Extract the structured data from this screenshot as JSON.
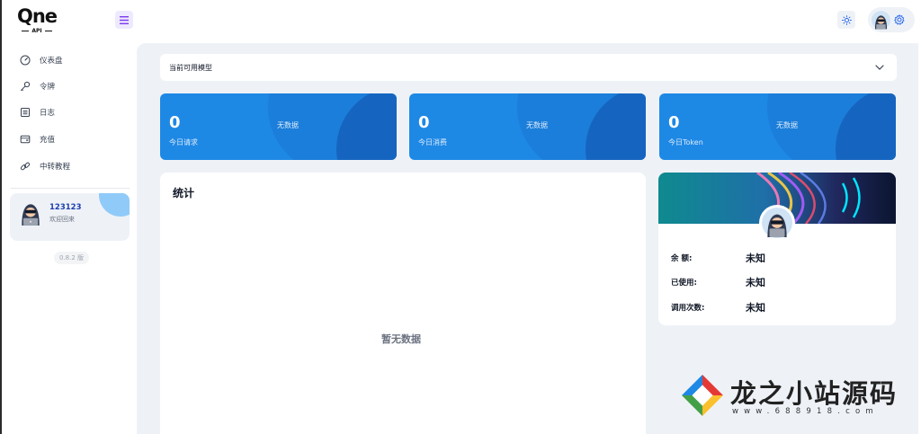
{
  "app": {
    "logo_text": "Qne",
    "logo_sub": "API"
  },
  "sidebar": {
    "items": [
      {
        "label": "仪表盘",
        "icon": "gauge-icon"
      },
      {
        "label": "令牌",
        "icon": "key-icon"
      },
      {
        "label": "日志",
        "icon": "log-icon"
      },
      {
        "label": "充值",
        "icon": "wallet-icon"
      },
      {
        "label": "中转教程",
        "icon": "link-icon"
      }
    ],
    "user": {
      "name": "123123",
      "greeting": "欢迎回来"
    },
    "version": "0.8.2 版"
  },
  "main": {
    "model_select": {
      "label": "当前可用模型"
    },
    "stats": [
      {
        "value": "0",
        "label": "今日请求",
        "nodata": "无数据"
      },
      {
        "value": "0",
        "label": "今日消费",
        "nodata": "无数据"
      },
      {
        "value": "0",
        "label": "今日Token",
        "nodata": "无数据"
      }
    ],
    "chart": {
      "title": "统计",
      "empty_text": "暂无数据"
    },
    "balance": {
      "rows": [
        {
          "key": "余 额:",
          "value": "未知"
        },
        {
          "key": "已使用:",
          "value": "未知"
        },
        {
          "key": "调用次数:",
          "value": "未知"
        }
      ]
    }
  },
  "watermark": {
    "title": "龙之小站源码",
    "url": "www.688918.com"
  },
  "colors": {
    "accent": "#1e88e5",
    "main_bg": "#eef2f7",
    "menu_toggle_bg": "#ede9fe",
    "link_blue": "#1e40af"
  }
}
